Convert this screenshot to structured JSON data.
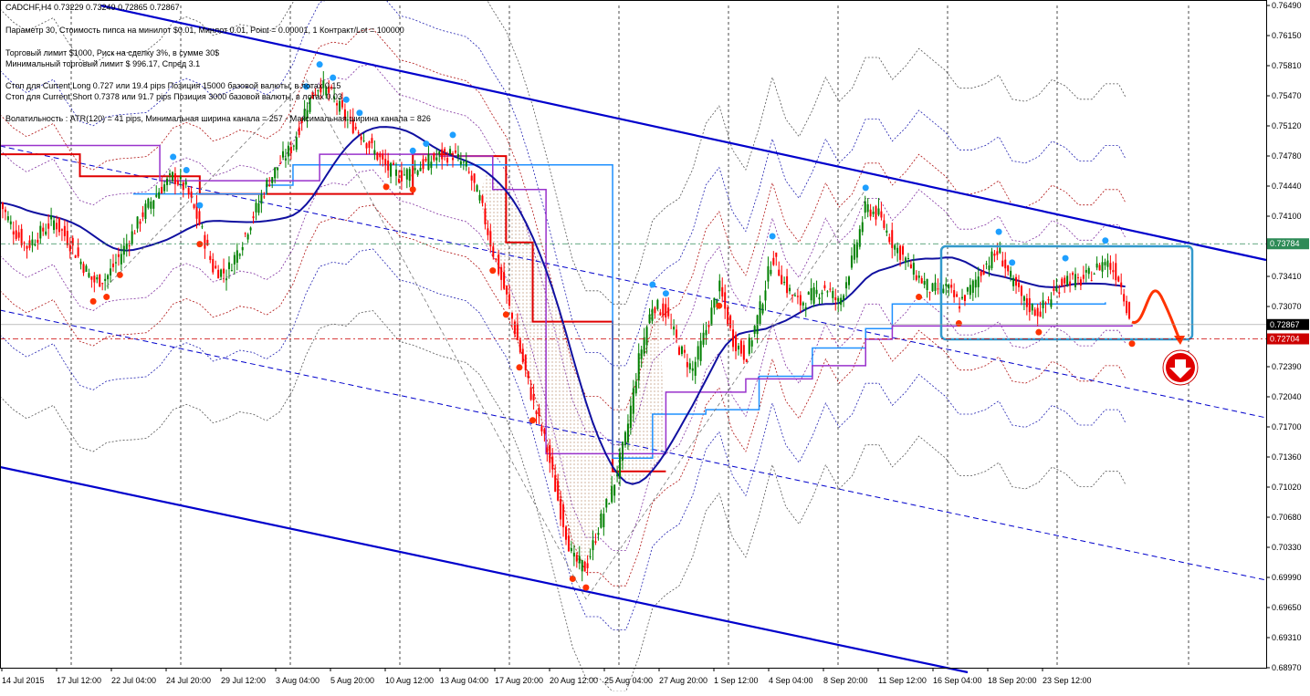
{
  "header": {
    "symbol_line": "CADCHF,H4  0.73229 0.73249 0.72865 0.72867"
  },
  "info_panel": {
    "lines": [
      "Параметр 30,  Стоимость пипса на минилот $0.01,  Минлот 0.01,  Point = 0.00001,  1 Контракт/Lot = 100000",
      "Торговый лимит $1000, Риск на сделку 3%,  в сумме 30$",
      "Минимальный торговый лимит $ 996.17,  Спред  3.1",
      "Стоп для Current Long  0.727  или  19.4 pips   Позиция 15000 базовой валюты,  в лотах 0.15",
      "Стоп для Current Short 0.7378  или  91.7 pips   Позиция 3000 базовой валюты,  в лотах 0.03",
      "Волатильность : ATR(120) = 41 pips,  Минимальная ширина канала = 257 - Максимальная ширина канала = 826"
    ]
  },
  "colors": {
    "bull": "#008000",
    "bear": "#ff0000",
    "channel_main": "#0000cc",
    "ma": "#1010a0",
    "stop_red": "#e00000",
    "stop_blue": "#1e90ff",
    "stop_purple": "#9932cc",
    "marker_high": "#1e9fff",
    "marker_low": "#ff3300",
    "rect_box": "#3399cc",
    "tag_green": "#2e8b57",
    "tag_black": "#000000",
    "tag_red": "#cc0000"
  },
  "chart_data": {
    "type": "candlestick",
    "symbol": "CADCHF",
    "timeframe": "H4",
    "ylim": [
      0.6897,
      0.7649
    ],
    "y_ticks": [
      "0.76490",
      "0.76150",
      "0.75810",
      "0.75470",
      "0.75120",
      "0.74780",
      "0.74440",
      "0.74100",
      "0.73760",
      "0.73410",
      "0.73070",
      "0.72730",
      "0.72390",
      "0.72040",
      "0.71700",
      "0.71360",
      "0.71020",
      "0.70680",
      "0.70330",
      "0.69990",
      "0.69650",
      "0.69310",
      "0.68970"
    ],
    "x_ticks": [
      "14 Jul 2015",
      "17 Jul 12:00",
      "22 Jul 04:00",
      "24 Jul 20:00",
      "29 Jul 12:00",
      "3 Aug 04:00",
      "5 Aug 20:00",
      "10 Aug 12:00",
      "13 Aug 04:00",
      "17 Aug 20:00",
      "20 Aug 12:00",
      "25 Aug 04:00",
      "27 Aug 20:00",
      "1 Sep 12:00",
      "4 Sep 04:00",
      "8 Sep 20:00",
      "11 Sep 12:00",
      "16 Sep 04:00",
      "18 Sep 20:00",
      "23 Sep 12:00"
    ],
    "price_tags": [
      {
        "value": 0.73784,
        "label": "0.73784",
        "kind": "green"
      },
      {
        "value": 0.72867,
        "label": "0.72867",
        "kind": "black"
      },
      {
        "value": 0.72704,
        "label": "0.72704",
        "kind": "red"
      }
    ],
    "close_path": [
      [
        0,
        0.7425
      ],
      [
        0.02,
        0.7395
      ],
      [
        0.04,
        0.7375
      ],
      [
        0.06,
        0.739
      ],
      [
        0.08,
        0.7405
      ],
      [
        0.1,
        0.7385
      ],
      [
        0.12,
        0.736
      ],
      [
        0.14,
        0.7335
      ],
      [
        0.16,
        0.734
      ],
      [
        0.18,
        0.7365
      ],
      [
        0.2,
        0.7392
      ],
      [
        0.22,
        0.742
      ],
      [
        0.24,
        0.744
      ],
      [
        0.26,
        0.7455
      ],
      [
        0.28,
        0.744
      ],
      [
        0.3,
        0.74
      ],
      [
        0.32,
        0.735
      ],
      [
        0.34,
        0.7345
      ],
      [
        0.36,
        0.7375
      ],
      [
        0.38,
        0.741
      ],
      [
        0.4,
        0.7445
      ],
      [
        0.42,
        0.747
      ],
      [
        0.44,
        0.749
      ],
      [
        0.46,
        0.7535
      ],
      [
        0.48,
        0.756
      ],
      [
        0.5,
        0.7545
      ],
      [
        0.52,
        0.752
      ],
      [
        0.54,
        0.7505
      ],
      [
        0.56,
        0.7485
      ],
      [
        0.58,
        0.7465
      ],
      [
        0.6,
        0.7455
      ],
      [
        0.62,
        0.7462
      ],
      [
        0.64,
        0.747
      ],
      [
        0.66,
        0.7478
      ],
      [
        0.68,
        0.748
      ],
      [
        0.7,
        0.7465
      ],
      [
        0.72,
        0.743
      ],
      [
        0.74,
        0.737
      ],
      [
        0.76,
        0.732
      ],
      [
        0.78,
        0.726
      ],
      [
        0.8,
        0.72
      ],
      [
        0.82,
        0.715
      ],
      [
        0.84,
        0.708
      ],
      [
        0.86,
        0.702
      ],
      [
        0.88,
        0.701
      ],
      [
        0.9,
        0.706
      ],
      [
        0.92,
        0.71
      ],
      [
        0.94,
        0.716
      ],
      [
        0.96,
        0.725
      ],
      [
        0.98,
        0.731
      ],
      [
        1.0,
        0.73
      ],
      [
        1.02,
        0.726
      ],
      [
        1.04,
        0.7235
      ],
      [
        1.06,
        0.728
      ],
      [
        1.08,
        0.733
      ],
      [
        1.1,
        0.727
      ],
      [
        1.12,
        0.725
      ],
      [
        1.14,
        0.73
      ],
      [
        1.16,
        0.7365
      ],
      [
        1.18,
        0.733
      ],
      [
        1.2,
        0.731
      ],
      [
        1.22,
        0.732
      ],
      [
        1.24,
        0.733
      ],
      [
        1.26,
        0.731
      ],
      [
        1.28,
        0.736
      ],
      [
        1.3,
        0.742
      ],
      [
        1.32,
        0.741
      ],
      [
        1.34,
        0.738
      ],
      [
        1.36,
        0.736
      ],
      [
        1.38,
        0.734
      ],
      [
        1.4,
        0.7325
      ],
      [
        1.42,
        0.733
      ],
      [
        1.44,
        0.731
      ],
      [
        1.46,
        0.733
      ],
      [
        1.48,
        0.7355
      ],
      [
        1.5,
        0.737
      ],
      [
        1.52,
        0.7335
      ],
      [
        1.54,
        0.731
      ],
      [
        1.56,
        0.73
      ],
      [
        1.58,
        0.732
      ],
      [
        1.6,
        0.734
      ],
      [
        1.62,
        0.7335
      ],
      [
        1.64,
        0.7345
      ],
      [
        1.66,
        0.736
      ],
      [
        1.68,
        0.734
      ],
      [
        1.7,
        0.7287
      ]
    ]
  }
}
